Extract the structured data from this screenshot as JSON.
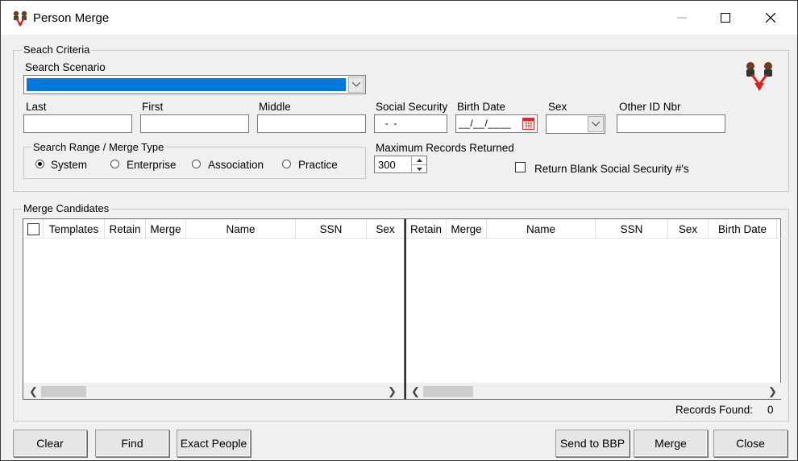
{
  "window": {
    "title": "Person Merge"
  },
  "search_criteria": {
    "group_label": "Seach Criteria",
    "scenario_label": "Search Scenario",
    "fields": {
      "last": "Last",
      "first": "First",
      "middle": "Middle",
      "social_security": "Social Security",
      "birth_date": "Birth Date",
      "sex": "Sex",
      "other_id": "Other ID Nbr"
    },
    "ssn_value": "  -  -",
    "birth_date_value": "__/__/____",
    "range": {
      "group_label": "Search Range / Merge Type",
      "options": [
        "System",
        "Enterprise",
        "Association",
        "Practice"
      ],
      "selected": "System"
    },
    "max_records_label": "Maximum Records Returned",
    "max_records_value": "300",
    "return_blank_ssn_label": "Return Blank Social Security #'s"
  },
  "merge_candidates": {
    "group_label": "Merge Candidates",
    "left_columns": [
      "Templates",
      "Retain",
      "Merge",
      "Name",
      "SSN",
      "Sex"
    ],
    "right_columns": [
      "Retain",
      "Merge",
      "Name",
      "SSN",
      "Sex",
      "Birth Date"
    ],
    "records_found_label": "Records Found:",
    "records_found_value": "0"
  },
  "buttons": {
    "clear": "Clear",
    "find": "Find",
    "exact_people": "Exact People",
    "send_to_bbp": "Send to BBP",
    "merge": "Merge",
    "close": "Close"
  },
  "colors": {
    "selection": "#0078d7",
    "window_bg": "#f0f0f0",
    "date_icon": "#d23030",
    "merge_arrow": "#e02020"
  },
  "icons": [
    "person-merge-icon",
    "minimize-icon",
    "maximize-icon",
    "close-icon",
    "chevron-down-icon",
    "calendar-icon",
    "spinner-up-icon",
    "spinner-down-icon",
    "scroll-left-icon",
    "scroll-right-icon"
  ]
}
